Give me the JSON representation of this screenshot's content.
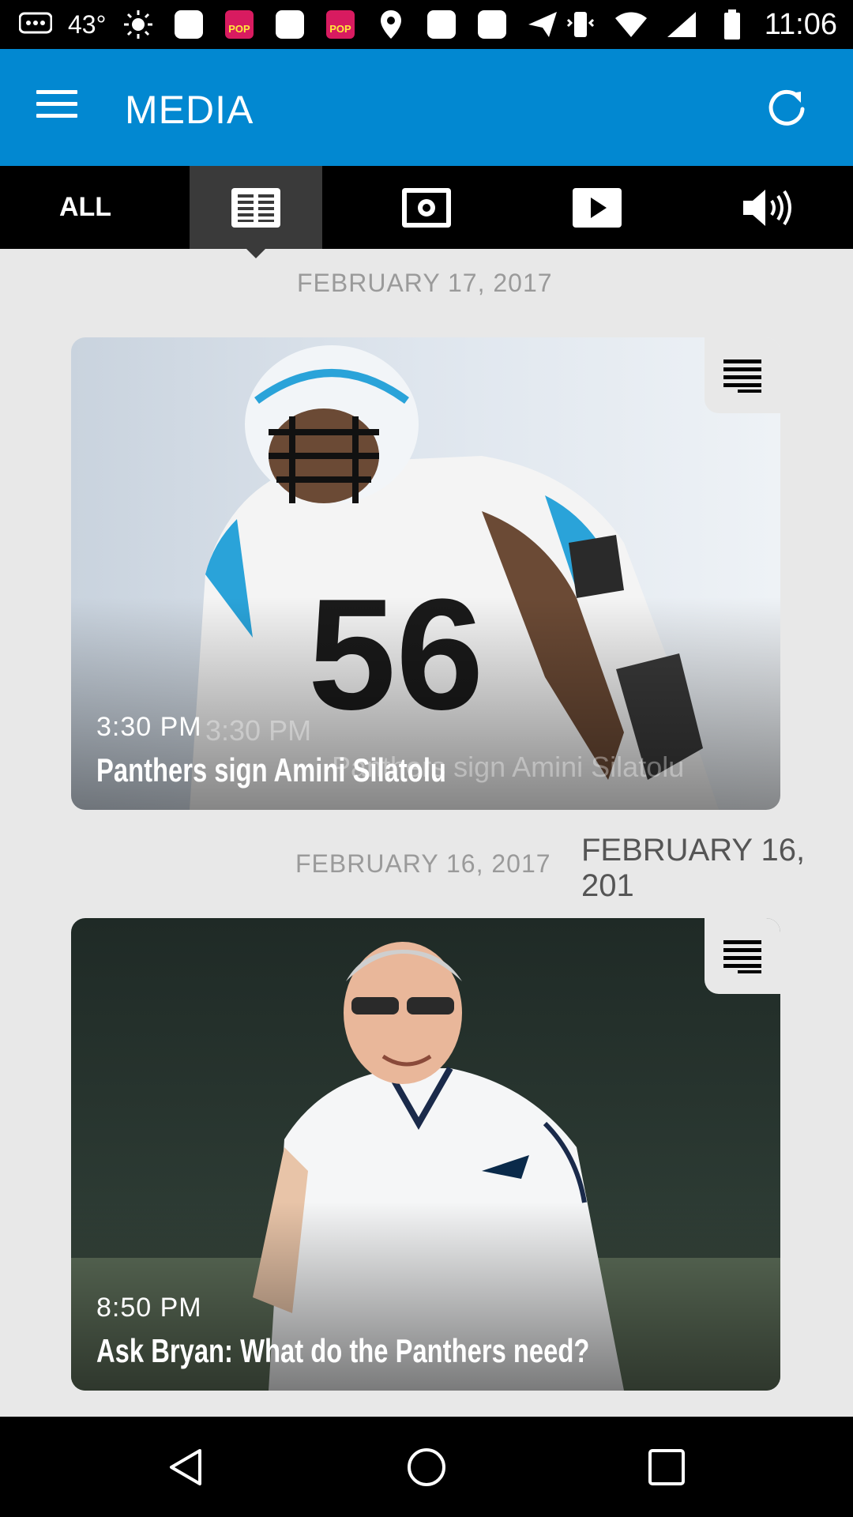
{
  "status_bar": {
    "temperature": "43°",
    "time": "11:06"
  },
  "app_bar": {
    "title": "MEDIA"
  },
  "tabs": {
    "all_label": "ALL",
    "icons": [
      "articles-icon",
      "photos-icon",
      "videos-icon",
      "audio-icon"
    ],
    "selected": "articles"
  },
  "feed": [
    {
      "date": "FEBRUARY 17, 2017",
      "time": "3:30 PM",
      "title": "Panthers sign Amini Silatolu",
      "type_icon": "article-lines-icon"
    },
    {
      "date": "FEBRUARY 16, 2017",
      "time": "8:50 PM",
      "title": "Ask Bryan: What do the Panthers need?",
      "type_icon": "article-lines-icon"
    }
  ],
  "ghost_overlays": {
    "time": "3:30 PM",
    "title": "Panthers sign Amini Silatolu",
    "date": "FEBRUARY 16, 201"
  },
  "colors": {
    "app_bar": "#0288d1",
    "background": "#e8e8e8",
    "tab_bar": "#000000",
    "tab_selected": "#3a3a3a"
  }
}
